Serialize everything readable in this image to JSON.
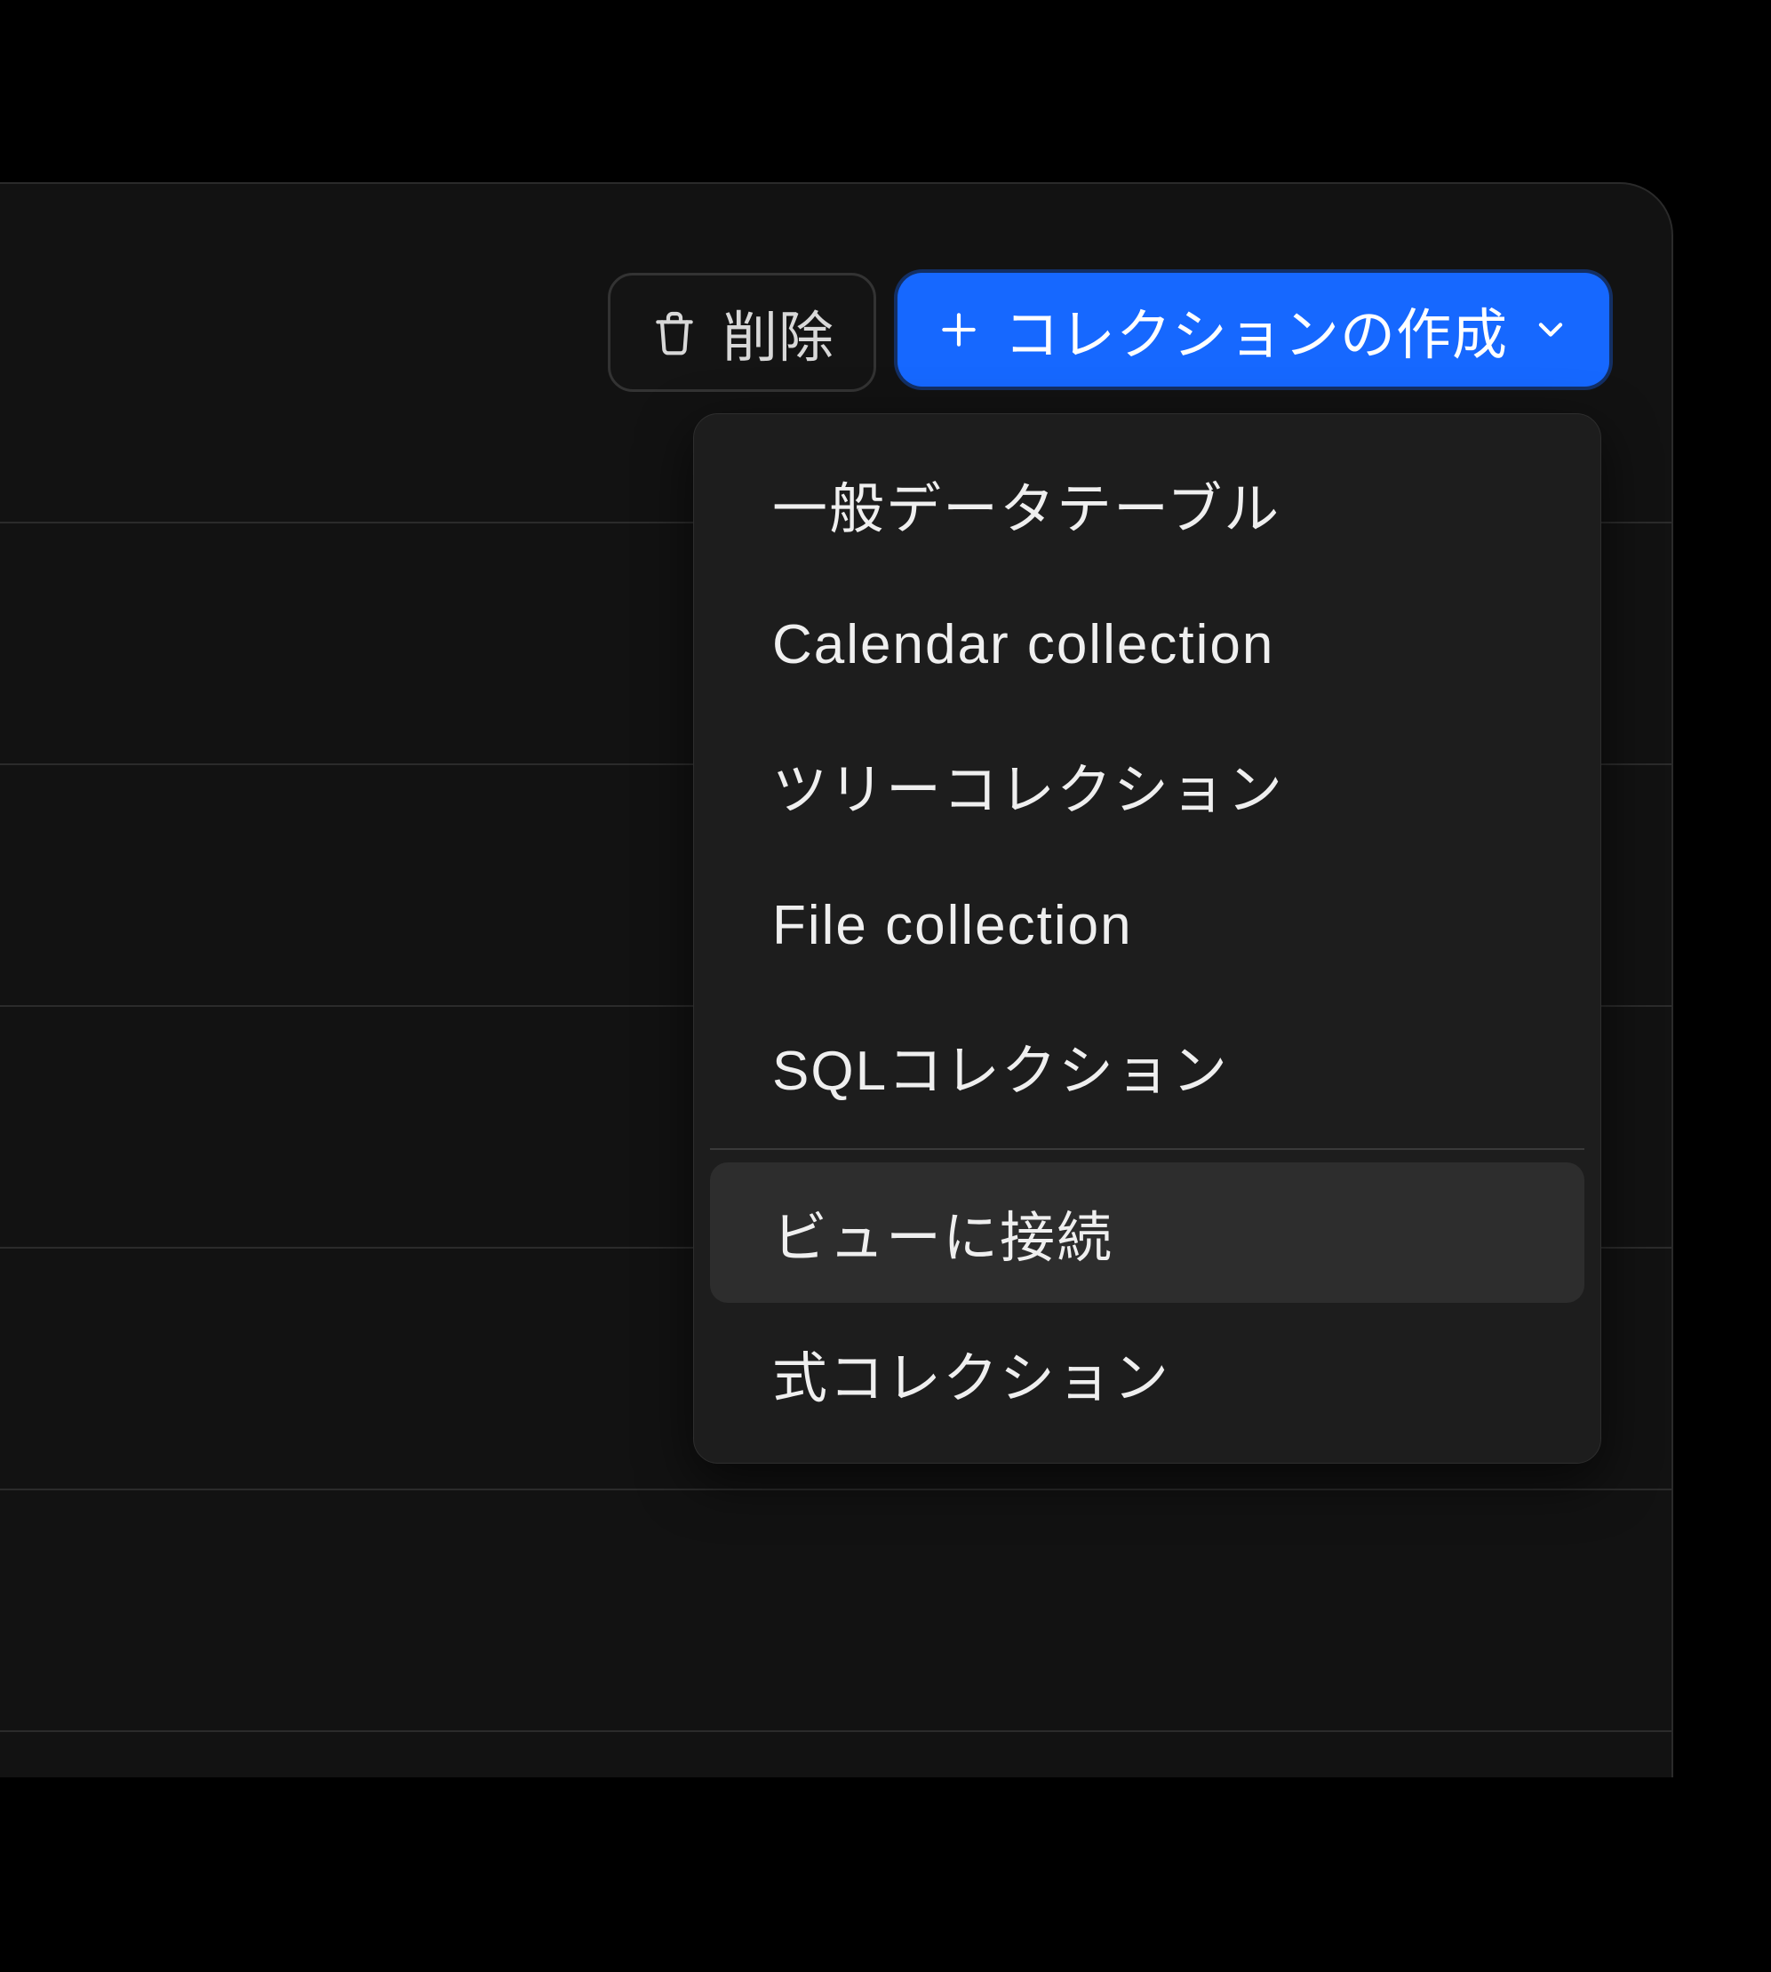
{
  "toolbar": {
    "delete_label": "削除",
    "create_label": "コレクションの作成"
  },
  "menu": {
    "items": [
      {
        "label": "一般データテーブル"
      },
      {
        "label": "Calendar collection"
      },
      {
        "label": "ツリーコレクション"
      },
      {
        "label": "File collection"
      },
      {
        "label": "SQLコレクション"
      }
    ],
    "secondary": [
      {
        "label": "ビューに接続",
        "hovered": true
      },
      {
        "label": "式コレクション"
      }
    ]
  }
}
